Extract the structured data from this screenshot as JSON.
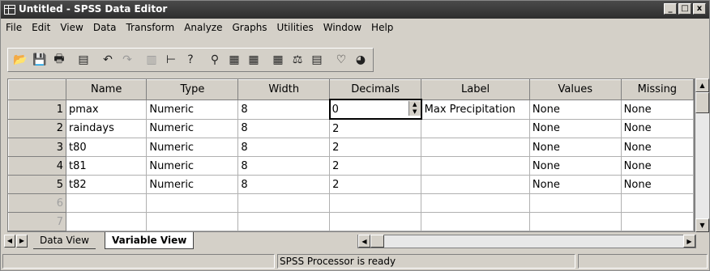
{
  "window": {
    "title": "Untitled - SPSS Data Editor",
    "controls": [
      "_",
      "□",
      "x"
    ]
  },
  "menu": [
    "File",
    "Edit",
    "View",
    "Data",
    "Transform",
    "Analyze",
    "Graphs",
    "Utilities",
    "Window",
    "Help"
  ],
  "toolbar": {
    "icons": [
      "open-icon",
      "save-icon",
      "print-icon",
      "dialog-recall-icon",
      "undo-icon",
      "redo-icon",
      "goto-chart-icon",
      "goto-case-icon",
      "variables-icon",
      "find-icon",
      "insert-case-icon",
      "insert-variable-icon",
      "split-file-icon",
      "weight-cases-icon",
      "select-cases-icon",
      "value-labels-icon",
      "use-sets-icon"
    ]
  },
  "grid": {
    "columns": [
      "Name",
      "Type",
      "Width",
      "Decimals",
      "Label",
      "Values",
      "Missing"
    ],
    "rows": [
      {
        "num": "1",
        "cells": [
          "pmax",
          "Numeric",
          "8",
          "0",
          "Max Precipitation",
          "None",
          "None"
        ]
      },
      {
        "num": "2",
        "cells": [
          "raindays",
          "Numeric",
          "8",
          "2",
          "",
          "None",
          "None"
        ]
      },
      {
        "num": "3",
        "cells": [
          "t80",
          "Numeric",
          "8",
          "2",
          "",
          "None",
          "None"
        ]
      },
      {
        "num": "4",
        "cells": [
          "t81",
          "Numeric",
          "8",
          "2",
          "",
          "None",
          "None"
        ]
      },
      {
        "num": "5",
        "cells": [
          "t82",
          "Numeric",
          "8",
          "2",
          "",
          "None",
          "None"
        ]
      },
      {
        "num": "6",
        "cells": [
          "",
          "",
          "",
          "",
          "",
          "",
          ""
        ]
      },
      {
        "num": "7",
        "cells": [
          "",
          "",
          "",
          "",
          "",
          "",
          ""
        ]
      }
    ]
  },
  "tabs": {
    "data_view": "Data View",
    "variable_view": "Variable View",
    "active": "variable_view"
  },
  "status": {
    "text": "SPSS Processor  is ready"
  }
}
